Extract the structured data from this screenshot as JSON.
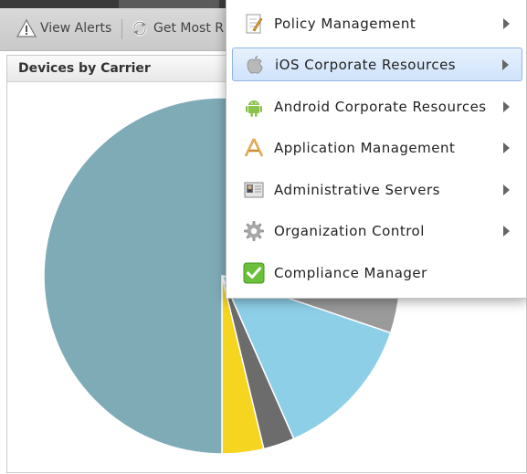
{
  "toolbar": {
    "view_alerts_label": "View Alerts",
    "get_most_label": "Get Most R"
  },
  "panel": {
    "title": "Devices by Carrier"
  },
  "menu": {
    "items": [
      {
        "label": "Policy Management",
        "icon": "document-pencil-icon",
        "has_submenu": true
      },
      {
        "label": "iOS Corporate Resources",
        "icon": "apple-icon",
        "has_submenu": true,
        "highlighted": true
      },
      {
        "label": "Android Corporate Resources",
        "icon": "android-icon",
        "has_submenu": true
      },
      {
        "label": "Application Management",
        "icon": "app-store-icon",
        "has_submenu": true
      },
      {
        "label": "Administrative Servers",
        "icon": "server-icon",
        "has_submenu": true
      },
      {
        "label": "Organization Control",
        "icon": "gear-icon",
        "has_submenu": true
      },
      {
        "label": "Compliance Manager",
        "icon": "checkmark-icon",
        "has_submenu": false
      }
    ]
  },
  "chart_data": {
    "type": "pie",
    "values": [
      81,
      4,
      14,
      3,
      4
    ],
    "colors": [
      "#7fabb7",
      "#9a9a9a",
      "#8ecfe8",
      "#6c6c6c",
      "#f5d51f"
    ]
  }
}
